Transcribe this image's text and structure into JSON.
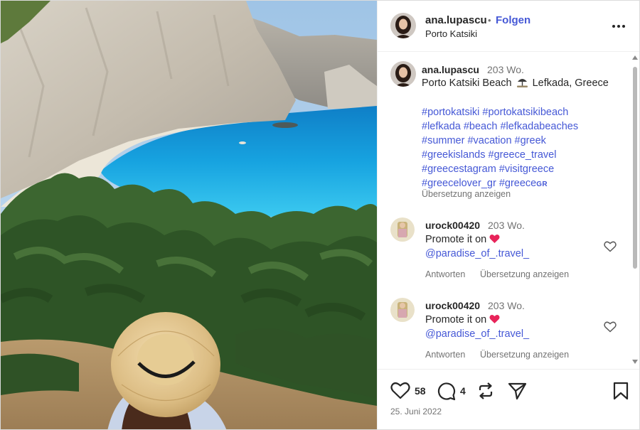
{
  "post": {
    "username": "ana.lupascu",
    "follow_label": "Folgen",
    "separator": "•",
    "location": "Porto Katsiki"
  },
  "caption": {
    "username": "ana.lupascu",
    "age": "203 Wo.",
    "text_before_icon": "Porto Katsiki Beach",
    "text_after_icon": "Lefkada, Greece",
    "hashtag_lines": [
      "#portokatsiki #portokatsikibeach",
      "#lefkada #beach #lefkadabeaches",
      "#summer #vacation #greek",
      "#greekislands #greece_travel",
      "#greecestagram #visitgreece",
      "#greecelover_gr #greece"
    ],
    "hashtag_suffix": "GR",
    "translate_label": "Übersetzung anzeigen"
  },
  "comments": [
    {
      "username": "urock00420",
      "age": "203 Wo.",
      "text": "Promote it on",
      "mention": "@paradise_of_.travel_",
      "reply_label": "Antworten",
      "translate_label": "Übersetzung anzeigen"
    },
    {
      "username": "urock00420",
      "age": "203 Wo.",
      "text": "Promote it on",
      "mention": "@paradise_of_.travel_",
      "reply_label": "Antworten",
      "translate_label": "Übersetzung anzeigen"
    }
  ],
  "actions": {
    "likes": "58",
    "comments": "4",
    "date": "25. Juni 2022"
  },
  "icons": {
    "more": "more-options-icon",
    "beach": "beach-umbrella-icon",
    "heart_emoji": "red-heart-emoji-icon",
    "like": "heart-icon",
    "comment": "comment-icon",
    "repost": "repost-icon",
    "share": "share-icon",
    "save": "bookmark-icon"
  },
  "colors": {
    "link_blue": "#4558d6",
    "muted": "#737373",
    "heart_red": "#e8245a"
  }
}
